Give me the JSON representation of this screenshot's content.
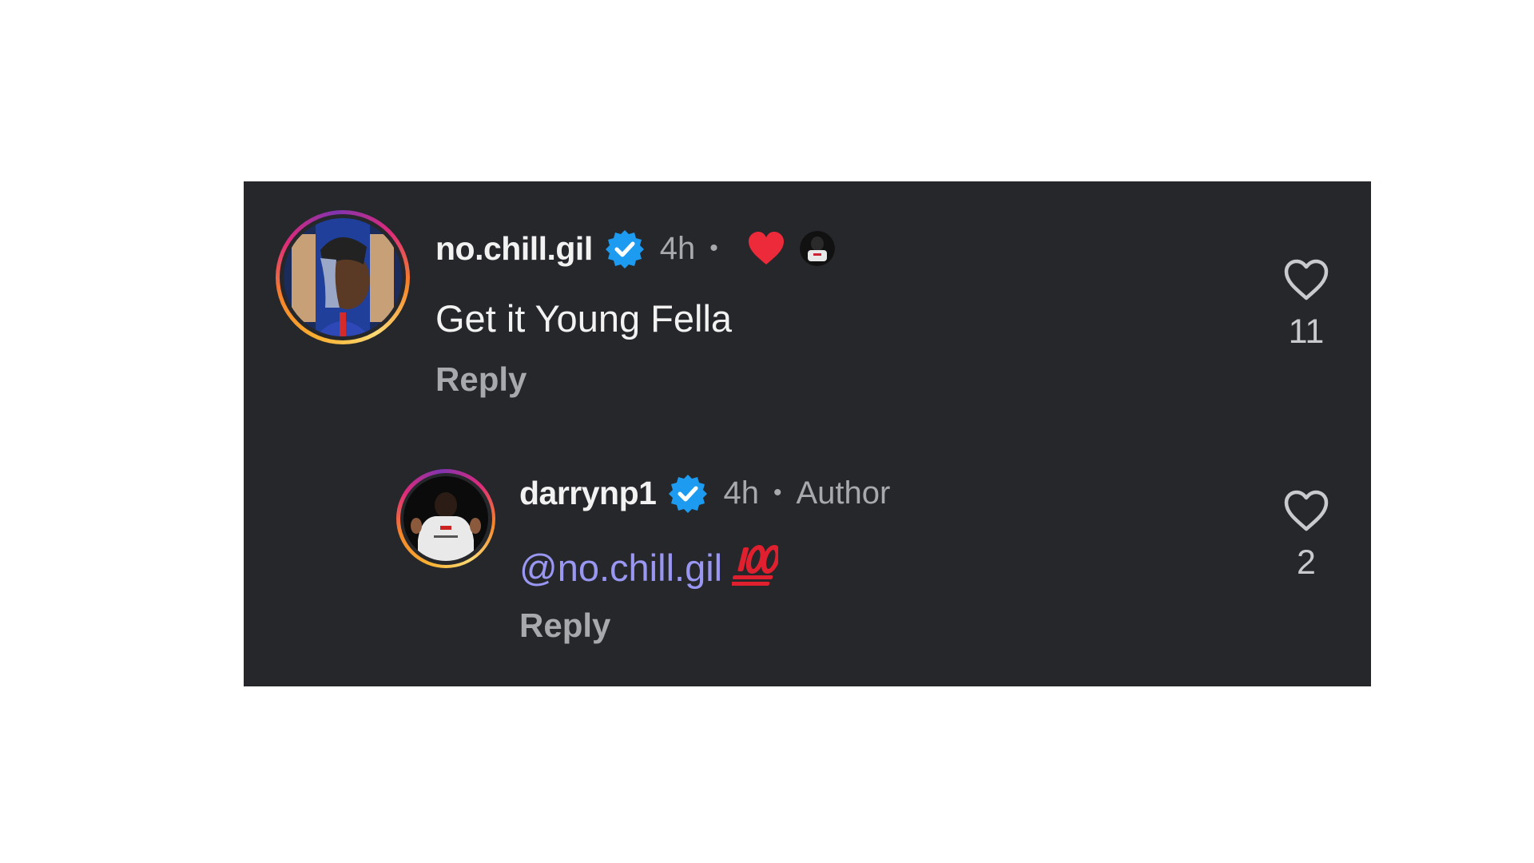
{
  "comments": [
    {
      "username": "no.chill.gil",
      "verified": true,
      "time": "4h",
      "liked_by_author": true,
      "text": "Get it Young Fella",
      "reply_label": "Reply",
      "like_count": "11",
      "avatar_icon": "avatar-no-chill-gil"
    }
  ],
  "reply": {
    "username": "darrynp1",
    "verified": true,
    "time": "4h",
    "badge": "Author",
    "mention": "@no.chill.gil",
    "emoji": "hundred-points-emoji",
    "reply_label": "Reply",
    "like_count": "2",
    "avatar_icon": "avatar-darrynp1"
  },
  "colors": {
    "panel_bg": "#25272b",
    "text_primary": "#f2f2f2",
    "text_secondary": "#a8a9ad",
    "mention": "#9a97f2",
    "verified_blue": "#1d9bf0",
    "liked_heart": "#ed2a3a",
    "emoji_red": "#e0202e"
  }
}
